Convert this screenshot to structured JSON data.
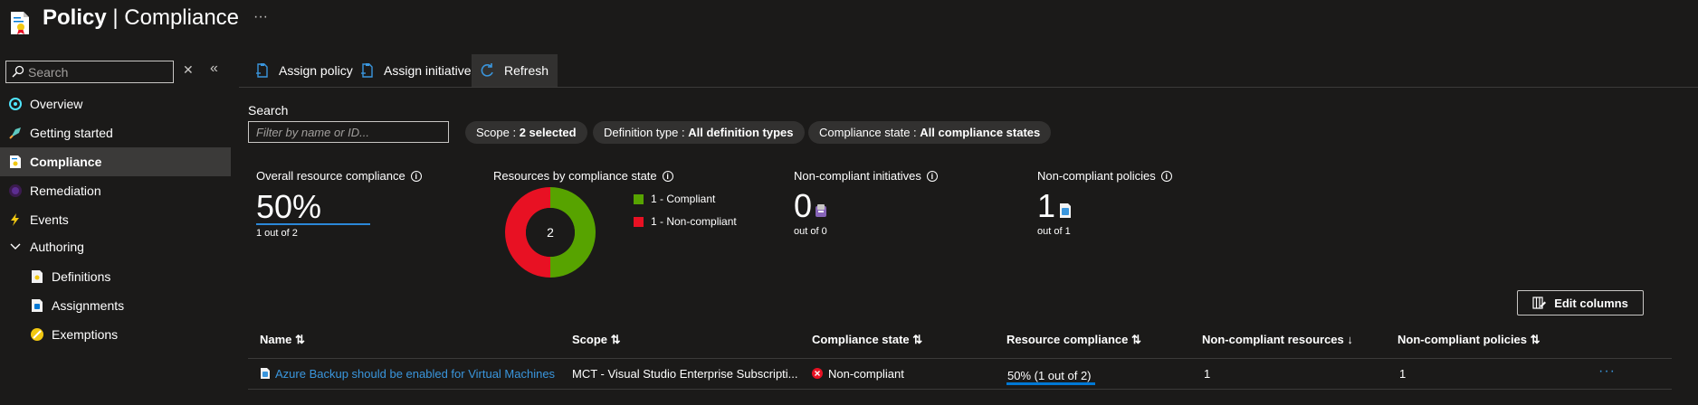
{
  "header": {
    "title_main": "Policy",
    "title_sep": "|",
    "title_sub": "Compliance",
    "more": "···",
    "icon": "policy-doc-icon"
  },
  "sidebar": {
    "search_placeholder": "Search",
    "clear": "✕",
    "collapse": "«",
    "items": [
      {
        "label": "Overview",
        "icon": "overview-icon"
      },
      {
        "label": "Getting started",
        "icon": "rocket-icon"
      },
      {
        "label": "Compliance",
        "icon": "compliance-icon",
        "active": true
      },
      {
        "label": "Remediation",
        "icon": "remediation-icon"
      },
      {
        "label": "Events",
        "icon": "lightning-icon"
      },
      {
        "label": "Authoring",
        "icon": "chevron-down-icon"
      },
      {
        "label": "Definitions",
        "icon": "definitions-icon"
      },
      {
        "label": "Assignments",
        "icon": "assignments-icon"
      },
      {
        "label": "Exemptions",
        "icon": "exemptions-icon"
      }
    ]
  },
  "toolbar": {
    "assign_policy": "Assign policy",
    "assign_initiative": "Assign initiative",
    "refresh": "Refresh"
  },
  "filters": {
    "search_label": "Search",
    "search_placeholder": "Filter by name or ID...",
    "scope_key": "Scope : ",
    "scope_value": "2 selected",
    "deftype_key": "Definition type : ",
    "deftype_value": "All definition types",
    "state_key": "Compliance state : ",
    "state_value": "All compliance states"
  },
  "stats": {
    "overall_title": "Overall resource compliance",
    "overall_value": "50%",
    "overall_sub": "1 out of 2",
    "by_state_title": "Resources by compliance state",
    "donut_total": "2",
    "legend_compliant": "1 - Compliant",
    "legend_noncompliant": "1 - Non-compliant",
    "initiatives_title": "Non-compliant initiatives",
    "initiatives_value": "0",
    "initiatives_sub": "out of 0",
    "policies_title": "Non-compliant policies",
    "policies_value": "1",
    "policies_sub": "out of 1",
    "info": "i",
    "colors": {
      "compliant": "#57a300",
      "noncompliant": "#e81123"
    }
  },
  "chart_data": {
    "type": "pie",
    "categories": [
      "Compliant",
      "Non-compliant"
    ],
    "values": [
      1,
      1
    ],
    "colors": [
      "#57a300",
      "#e81123"
    ],
    "center_label": "2"
  },
  "table": {
    "edit_columns": "Edit columns",
    "headers": {
      "name": "Name ⇅",
      "scope": "Scope ⇅",
      "state": "Compliance state ⇅",
      "resource_compliance": "Resource compliance ⇅",
      "nc_resources": "Non-compliant resources ↓",
      "nc_policies": "Non-compliant policies ⇅"
    },
    "rows": [
      {
        "name": "Azure Backup should be enabled for Virtual Machines",
        "scope": "MCT - Visual Studio Enterprise Subscripti...",
        "state": "Non-compliant",
        "resource_compliance": "50% (1 out of 2)",
        "resource_compliance_fraction": 0.5,
        "nc_resources": "1",
        "nc_policies": "1",
        "more": "···"
      }
    ]
  }
}
